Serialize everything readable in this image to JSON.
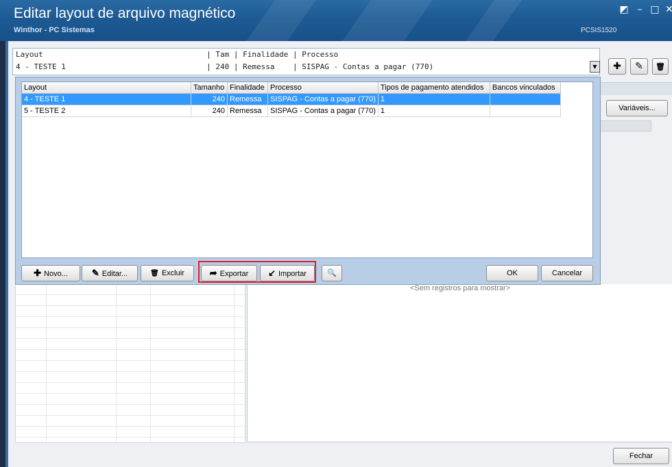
{
  "window": {
    "title": "Editar layout de arquivo magnético",
    "subtitle": "Winthor - PC Sistemas",
    "routine_code": "PCSIS1520",
    "controls": {
      "restore": "◩",
      "minimize": "–",
      "maximize": "□",
      "close": "✕"
    }
  },
  "layout_combo": {
    "header": "Layout                                    | Tam | Finalidade | Processo",
    "value": "4 - TESTE 1                               | 240 | Remessa    | SISPAG - Contas a pagar (770)",
    "dropdown_arrow": "▼"
  },
  "toolbar_right": {
    "add_icon": "✚",
    "edit_icon": "✎",
    "delete_icon": "🗑"
  },
  "variaveis_label": "Variáveis...",
  "popup": {
    "columns": [
      "Layout",
      "Tamanho",
      "Finalidade",
      "Processo",
      "Tipos de pagamento atendidos",
      "Bancos vinculados"
    ],
    "rows": [
      {
        "layout": "4 - TESTE 1",
        "tamanho": "240",
        "finalidade": "Remessa",
        "processo": "SISPAG - Contas a pagar (770)",
        "tipos": "1",
        "bancos": "",
        "selected": true
      },
      {
        "layout": "5 - TESTE 2",
        "tamanho": "240",
        "finalidade": "Remessa",
        "processo": "SISPAG - Contas a pagar (770)",
        "tipos": "1",
        "bancos": "",
        "selected": false
      }
    ],
    "buttons": {
      "novo": "Novo...",
      "editar": "Editar...",
      "excluir": "Excluir",
      "exportar": "Exportar",
      "importar": "Importar",
      "ok": "OK",
      "cancelar": "Cancelar"
    },
    "icons": {
      "novo": "✚",
      "editar": "✎",
      "excluir": "🗑",
      "exportar": "➦",
      "importar": "↙",
      "search": "🔍"
    }
  },
  "no_records_text": "<Sem registros para mostrar>",
  "fechar_label": "Fechar",
  "colors": {
    "titlebar": "#1d5a93",
    "selection": "#3399ff",
    "highlight_box": "#e0202a",
    "popup_bg": "#b8cde6"
  }
}
